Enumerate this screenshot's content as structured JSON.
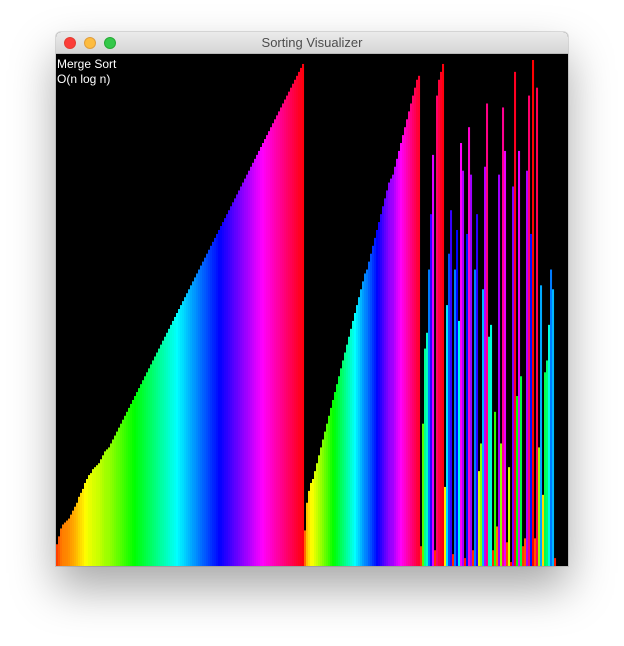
{
  "window": {
    "title": "Sorting Visualizer"
  },
  "overlay": {
    "algorithm": "Merge Sort",
    "complexity": "O(n log n)"
  },
  "chart_data": {
    "type": "bar",
    "ylim": [
      0,
      256
    ],
    "count": 256,
    "color_mode": "hue by value (red → yellow → green → cyan → blue → magenta → red)",
    "values": [
      11,
      15,
      19,
      21,
      22,
      23,
      24,
      26,
      28,
      30,
      32,
      35,
      37,
      39,
      42,
      44,
      46,
      47,
      49,
      50,
      51,
      52,
      54,
      56,
      58,
      59,
      60,
      62,
      64,
      66,
      68,
      70,
      72,
      74,
      76,
      78,
      80,
      82,
      84,
      86,
      88,
      90,
      92,
      94,
      96,
      98,
      100,
      102,
      104,
      106,
      108,
      110,
      112,
      114,
      116,
      118,
      120,
      122,
      124,
      126,
      128,
      130,
      132,
      134,
      136,
      138,
      140,
      142,
      144,
      146,
      148,
      150,
      152,
      154,
      156,
      158,
      160,
      162,
      164,
      166,
      168,
      170,
      172,
      174,
      176,
      178,
      180,
      182,
      184,
      186,
      188,
      190,
      192,
      194,
      196,
      198,
      200,
      202,
      204,
      206,
      208,
      210,
      212,
      214,
      216,
      218,
      220,
      222,
      224,
      226,
      228,
      230,
      232,
      234,
      236,
      238,
      240,
      242,
      244,
      246,
      248,
      250,
      252,
      254,
      18,
      32,
      38,
      42,
      44,
      48,
      52,
      56,
      60,
      64,
      68,
      72,
      76,
      80,
      84,
      88,
      92,
      96,
      100,
      104,
      108,
      112,
      116,
      120,
      124,
      128,
      132,
      136,
      140,
      144,
      148,
      150,
      154,
      158,
      162,
      166,
      170,
      174,
      178,
      182,
      186,
      190,
      194,
      196,
      198,
      202,
      206,
      210,
      214,
      218,
      222,
      226,
      230,
      234,
      238,
      242,
      246,
      248,
      10,
      72,
      110,
      118,
      150,
      178,
      208,
      8,
      238,
      246,
      250,
      254,
      40,
      132,
      158,
      180,
      6,
      150,
      170,
      124,
      214,
      200,
      4,
      168,
      222,
      198,
      8,
      150,
      178,
      48,
      62,
      140,
      202,
      234,
      116,
      122,
      8,
      78,
      20,
      198,
      62,
      232,
      210,
      12,
      50,
      2,
      192,
      250,
      86,
      210,
      96,
      10,
      14,
      200,
      238,
      168,
      256,
      14,
      242,
      60,
      142,
      36,
      98,
      104,
      122,
      150,
      140,
      4
    ]
  }
}
